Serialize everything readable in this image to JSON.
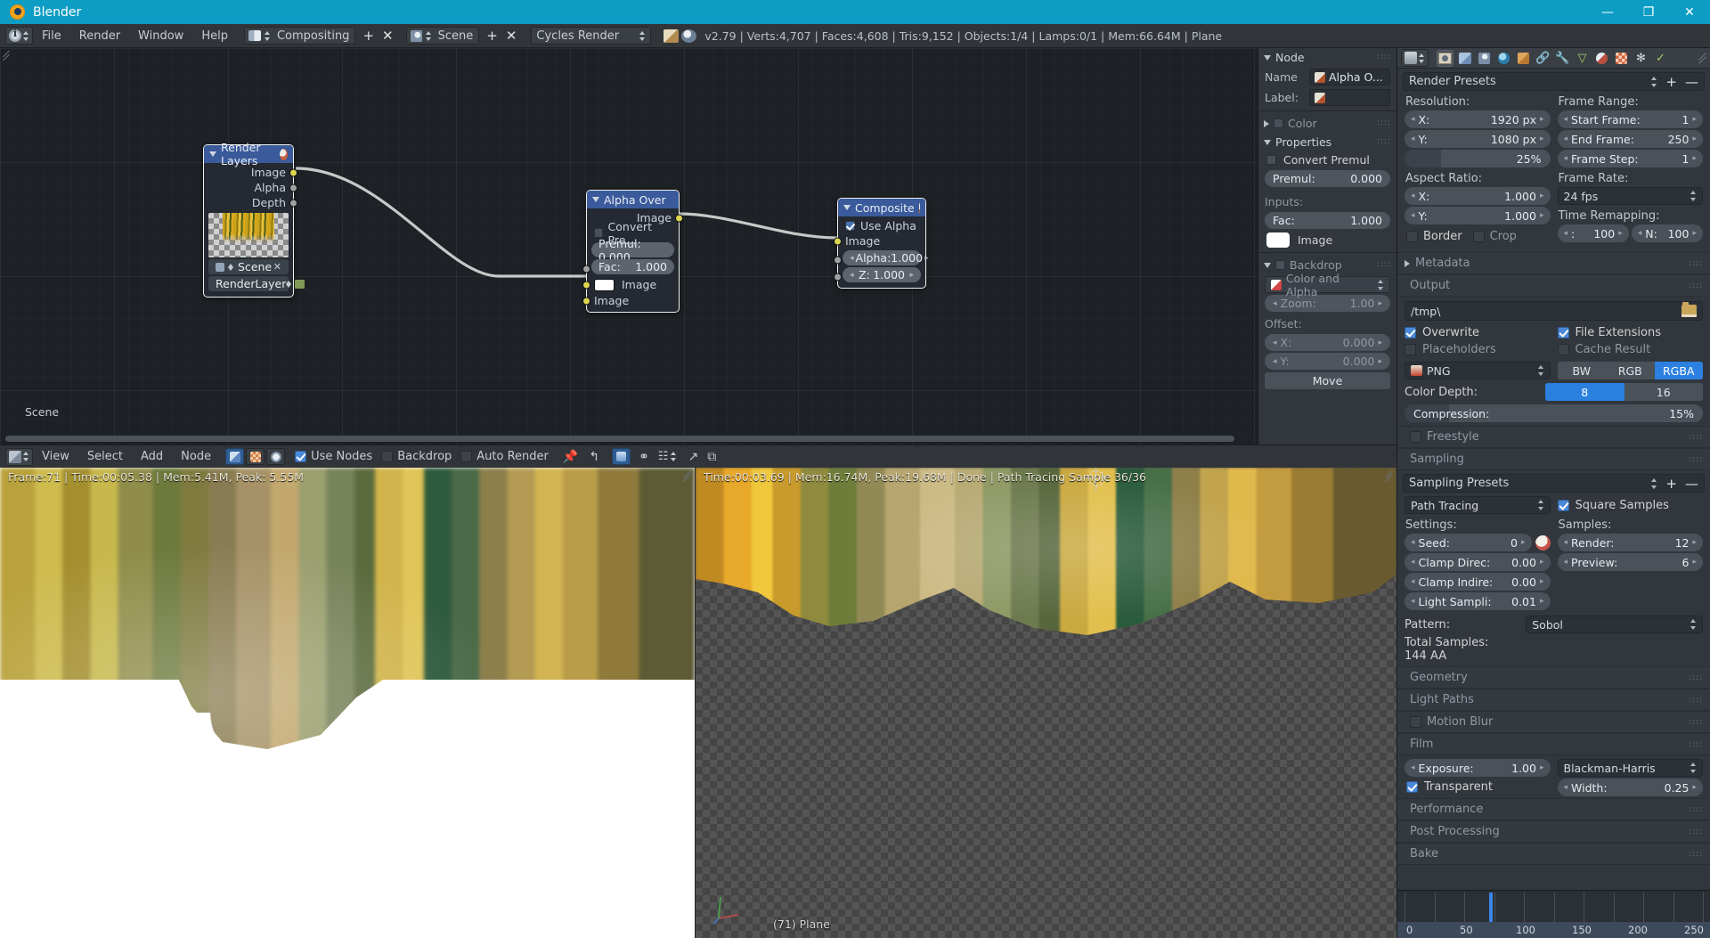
{
  "window": {
    "title": "Blender",
    "minimize": "—",
    "maximize": "❐",
    "close": "✕"
  },
  "topbar": {
    "menus": [
      "File",
      "Render",
      "Window",
      "Help"
    ],
    "screen_layout": "Compositing",
    "scene": "Scene",
    "engine": "Cycles Render",
    "add_label": "+",
    "close_label": "✕",
    "stats": "v2.79 | Verts:4,707 | Faces:4,608 | Tris:9,152 | Objects:1/4 | Lamps:0/1 | Mem:66.64M | Plane"
  },
  "node_editor": {
    "scene_label": "Scene",
    "nodes": [
      {
        "title": "Render Layers",
        "outputs": [
          "Image",
          "Alpha",
          "Depth"
        ],
        "scene_field": "Scene",
        "layer_field": "RenderLayer"
      },
      {
        "title": "Alpha Over",
        "output": "Image",
        "convert_premul": "Convert Pre...",
        "premul": "Premul: 0.000",
        "fac_label": "Fac:",
        "fac_value": "1.000",
        "image_input_1": "Image",
        "image_input_2": "Image"
      },
      {
        "title": "Composite",
        "use_alpha": "Use Alpha",
        "image_input": "Image",
        "alpha_label": "Alpha:",
        "alpha_value": "1.000",
        "z_label": "Z:",
        "z_value": "1.000"
      }
    ],
    "header": {
      "menus": [
        "View",
        "Select",
        "Add",
        "Node"
      ],
      "use_nodes": "Use Nodes",
      "backdrop": "Backdrop",
      "auto_render": "Auto Render"
    }
  },
  "npanel": {
    "node_section": "Node",
    "name_label": "Name",
    "name_value": "Alpha O...",
    "label_label": "Label:",
    "label_value": "",
    "color_section": "Color",
    "properties_section": "Properties",
    "convert_premul": "Convert Premul",
    "premul_label": "Premul:",
    "premul_value": "0.000",
    "inputs_label": "Inputs:",
    "fac_label": "Fac:",
    "fac_value": "1.000",
    "image_label": "Image",
    "backdrop_section": "Backdrop",
    "channel_value": "Color and Alpha",
    "zoom_label": "Zoom:",
    "zoom_value": "1.00",
    "offset_label": "Offset:",
    "offset_x_label": "X:",
    "offset_x_value": "0.000",
    "offset_y_label": "Y:",
    "offset_y_value": "0.000",
    "move_label": "Move"
  },
  "image_editors": {
    "left_status": "Frame:71 | Time:00:05.38 | Mem:5.41M, Peak: 5.55M",
    "right_status": "Time:00:03.69 | Mem:16.74M, Peak:19.68M | Done | Path Tracing Sample 36/36",
    "object_label": "(71) Plane"
  },
  "properties": {
    "preset_name": "Render Presets",
    "preset_plus": "+",
    "preset_minus": "—",
    "dimensions": {
      "resolution_label": "Resolution:",
      "res_x_label": "X:",
      "res_x_value": "1920 px",
      "res_y_label": "Y:",
      "res_y_value": "1080 px",
      "res_percent": "25%",
      "aspect_label": "Aspect Ratio:",
      "aspect_x_label": "X:",
      "aspect_x_value": "1.000",
      "aspect_y_label": "Y:",
      "aspect_y_value": "1.000",
      "border": "Border",
      "crop": "Crop",
      "frame_range_label": "Frame Range:",
      "start_frame_label": "Start Frame:",
      "start_frame_value": "1",
      "end_frame_label": "End Frame:",
      "end_frame_value": "250",
      "frame_step_label": "Frame Step:",
      "frame_step_value": "1",
      "frame_rate_label": "Frame Rate:",
      "frame_rate_value": "24 fps",
      "time_remapping_label": "Time Remapping:",
      "remap_old_label": ":",
      "remap_old_value": "100",
      "remap_new_label": "N:",
      "remap_new_value": "100"
    },
    "metadata_section": "Metadata",
    "output_section": "Output",
    "output": {
      "path": "/tmp\\",
      "overwrite": "Overwrite",
      "file_extensions": "File Extensions",
      "placeholders": "Placeholders",
      "cache_result": "Cache Result",
      "format": "PNG",
      "channels": [
        "BW",
        "RGB",
        "RGBA"
      ],
      "channels_selected": "RGBA",
      "color_depth_label": "Color Depth:",
      "color_depth_options": [
        "8",
        "16"
      ],
      "color_depth_selected": "8",
      "compression_label": "Compression:",
      "compression_value": "15%"
    },
    "freestyle_section": "Freestyle",
    "sampling_section": "Sampling",
    "sampling": {
      "preset_name": "Sampling Presets",
      "preset_plus": "+",
      "preset_minus": "—",
      "integrator": "Path Tracing",
      "square_samples": "Square Samples",
      "settings_label": "Settings:",
      "seed_label": "Seed:",
      "seed_value": "0",
      "clamp_direct_label": "Clamp Direc:",
      "clamp_direct_value": "0.00",
      "clamp_indirect_label": "Clamp Indire:",
      "clamp_indirect_value": "0.00",
      "light_sampling_label": "Light Sampli:",
      "light_sampling_value": "0.01",
      "samples_label": "Samples:",
      "render_label": "Render:",
      "render_value": "12",
      "preview_label": "Preview:",
      "preview_value": "6",
      "pattern_label": "Pattern:",
      "pattern_value": "Sobol",
      "total_samples_label": "Total Samples:",
      "total_samples_value": "144 AA"
    },
    "geometry_section": "Geometry",
    "light_paths_section": "Light Paths",
    "motion_blur_section": "Motion Blur",
    "film_section": "Film",
    "film": {
      "exposure_label": "Exposure:",
      "exposure_value": "1.00",
      "transparent": "Transparent",
      "filter_type": "Blackman-Harris",
      "width_label": "Width:",
      "width_value": "0.25"
    },
    "performance_section": "Performance",
    "post_processing_section": "Post Processing",
    "bake_section": "Bake"
  },
  "timeline": {
    "ticks": [
      "0",
      "50",
      "100",
      "150",
      "200",
      "250"
    ],
    "playhead_frame": 71,
    "start": 0,
    "end": 250
  },
  "colors": {
    "title_bar": "#0d9dc4",
    "accent_blue": "#2b80e0",
    "node_header_blue": "#3a5a9b",
    "socket_yellow": "#ddd550",
    "socket_grey": "#a1a1a1"
  }
}
